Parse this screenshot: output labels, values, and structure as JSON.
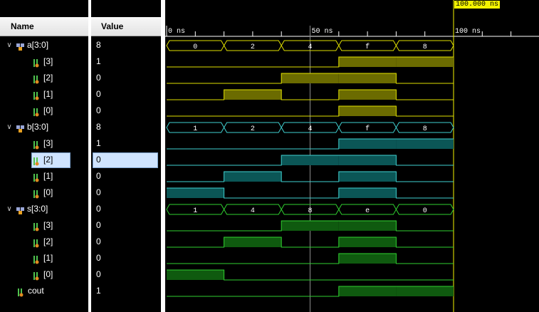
{
  "colors": {
    "accent_a": "#e0e000",
    "fill_a": "#6b6b00",
    "accent_b": "#40d0d0",
    "fill_b": "#0b5656",
    "accent_s": "#30d030",
    "fill_s": "#0f5a0f",
    "cursor": "#f3f300",
    "badge_text": "#000000"
  },
  "header": {
    "name": "Name",
    "value": "Value"
  },
  "timeline": {
    "cursor_time": "100.000 ns",
    "ticks": [
      "0 ns",
      "50 ns",
      "100 ns"
    ],
    "segment_times": [
      0,
      20,
      40,
      60,
      80,
      100
    ]
  },
  "signals": [
    {
      "name": "a[3:0]",
      "value": "8",
      "type": "bus",
      "group": "a",
      "expanded": true,
      "icon": "bus-icon",
      "segments": [
        "0",
        "2",
        "4",
        "f",
        "8"
      ]
    },
    {
      "name": "[3]",
      "value": "1",
      "type": "bit",
      "group": "a",
      "icon": "signal-bit-icon",
      "bits": [
        0,
        0,
        0,
        1,
        1
      ]
    },
    {
      "name": "[2]",
      "value": "0",
      "type": "bit",
      "group": "a",
      "icon": "signal-bit-icon",
      "bits": [
        0,
        0,
        1,
        1,
        0
      ]
    },
    {
      "name": "[1]",
      "value": "0",
      "type": "bit",
      "group": "a",
      "icon": "signal-bit-icon",
      "bits": [
        0,
        1,
        0,
        1,
        0
      ]
    },
    {
      "name": "[0]",
      "value": "0",
      "type": "bit",
      "group": "a",
      "icon": "signal-bit-icon",
      "bits": [
        0,
        0,
        0,
        1,
        0
      ]
    },
    {
      "name": "b[3:0]",
      "value": "8",
      "type": "bus",
      "group": "b",
      "expanded": true,
      "icon": "bus-icon",
      "segments": [
        "1",
        "2",
        "4",
        "f",
        "8"
      ]
    },
    {
      "name": "[3]",
      "value": "1",
      "type": "bit",
      "group": "b",
      "icon": "signal-bit-icon",
      "bits": [
        0,
        0,
        0,
        1,
        1
      ]
    },
    {
      "name": "[2]",
      "value": "0",
      "type": "bit",
      "group": "b",
      "icon": "signal-bit-icon",
      "bits": [
        0,
        0,
        1,
        1,
        0
      ],
      "selected": true
    },
    {
      "name": "[1]",
      "value": "0",
      "type": "bit",
      "group": "b",
      "icon": "signal-bit-icon",
      "bits": [
        0,
        1,
        0,
        1,
        0
      ]
    },
    {
      "name": "[0]",
      "value": "0",
      "type": "bit",
      "group": "b",
      "icon": "signal-bit-icon",
      "bits": [
        1,
        0,
        0,
        1,
        0
      ]
    },
    {
      "name": "s[3:0]",
      "value": "0",
      "type": "bus",
      "group": "s",
      "expanded": true,
      "icon": "bus-icon",
      "segments": [
        "1",
        "4",
        "8",
        "e",
        "0"
      ]
    },
    {
      "name": "[3]",
      "value": "0",
      "type": "bit",
      "group": "s",
      "icon": "signal-bit-icon",
      "bits": [
        0,
        0,
        1,
        1,
        0
      ]
    },
    {
      "name": "[2]",
      "value": "0",
      "type": "bit",
      "group": "s",
      "icon": "signal-bit-icon",
      "bits": [
        0,
        1,
        0,
        1,
        0
      ]
    },
    {
      "name": "[1]",
      "value": "0",
      "type": "bit",
      "group": "s",
      "icon": "signal-bit-icon",
      "bits": [
        0,
        0,
        0,
        1,
        0
      ]
    },
    {
      "name": "[0]",
      "value": "0",
      "type": "bit",
      "group": "s",
      "icon": "signal-bit-icon",
      "bits": [
        1,
        0,
        0,
        0,
        0
      ]
    },
    {
      "name": "cout",
      "value": "1",
      "type": "bit",
      "group": "s",
      "icon": "signal-bit-icon",
      "bits": [
        0,
        0,
        0,
        1,
        1
      ]
    }
  ]
}
